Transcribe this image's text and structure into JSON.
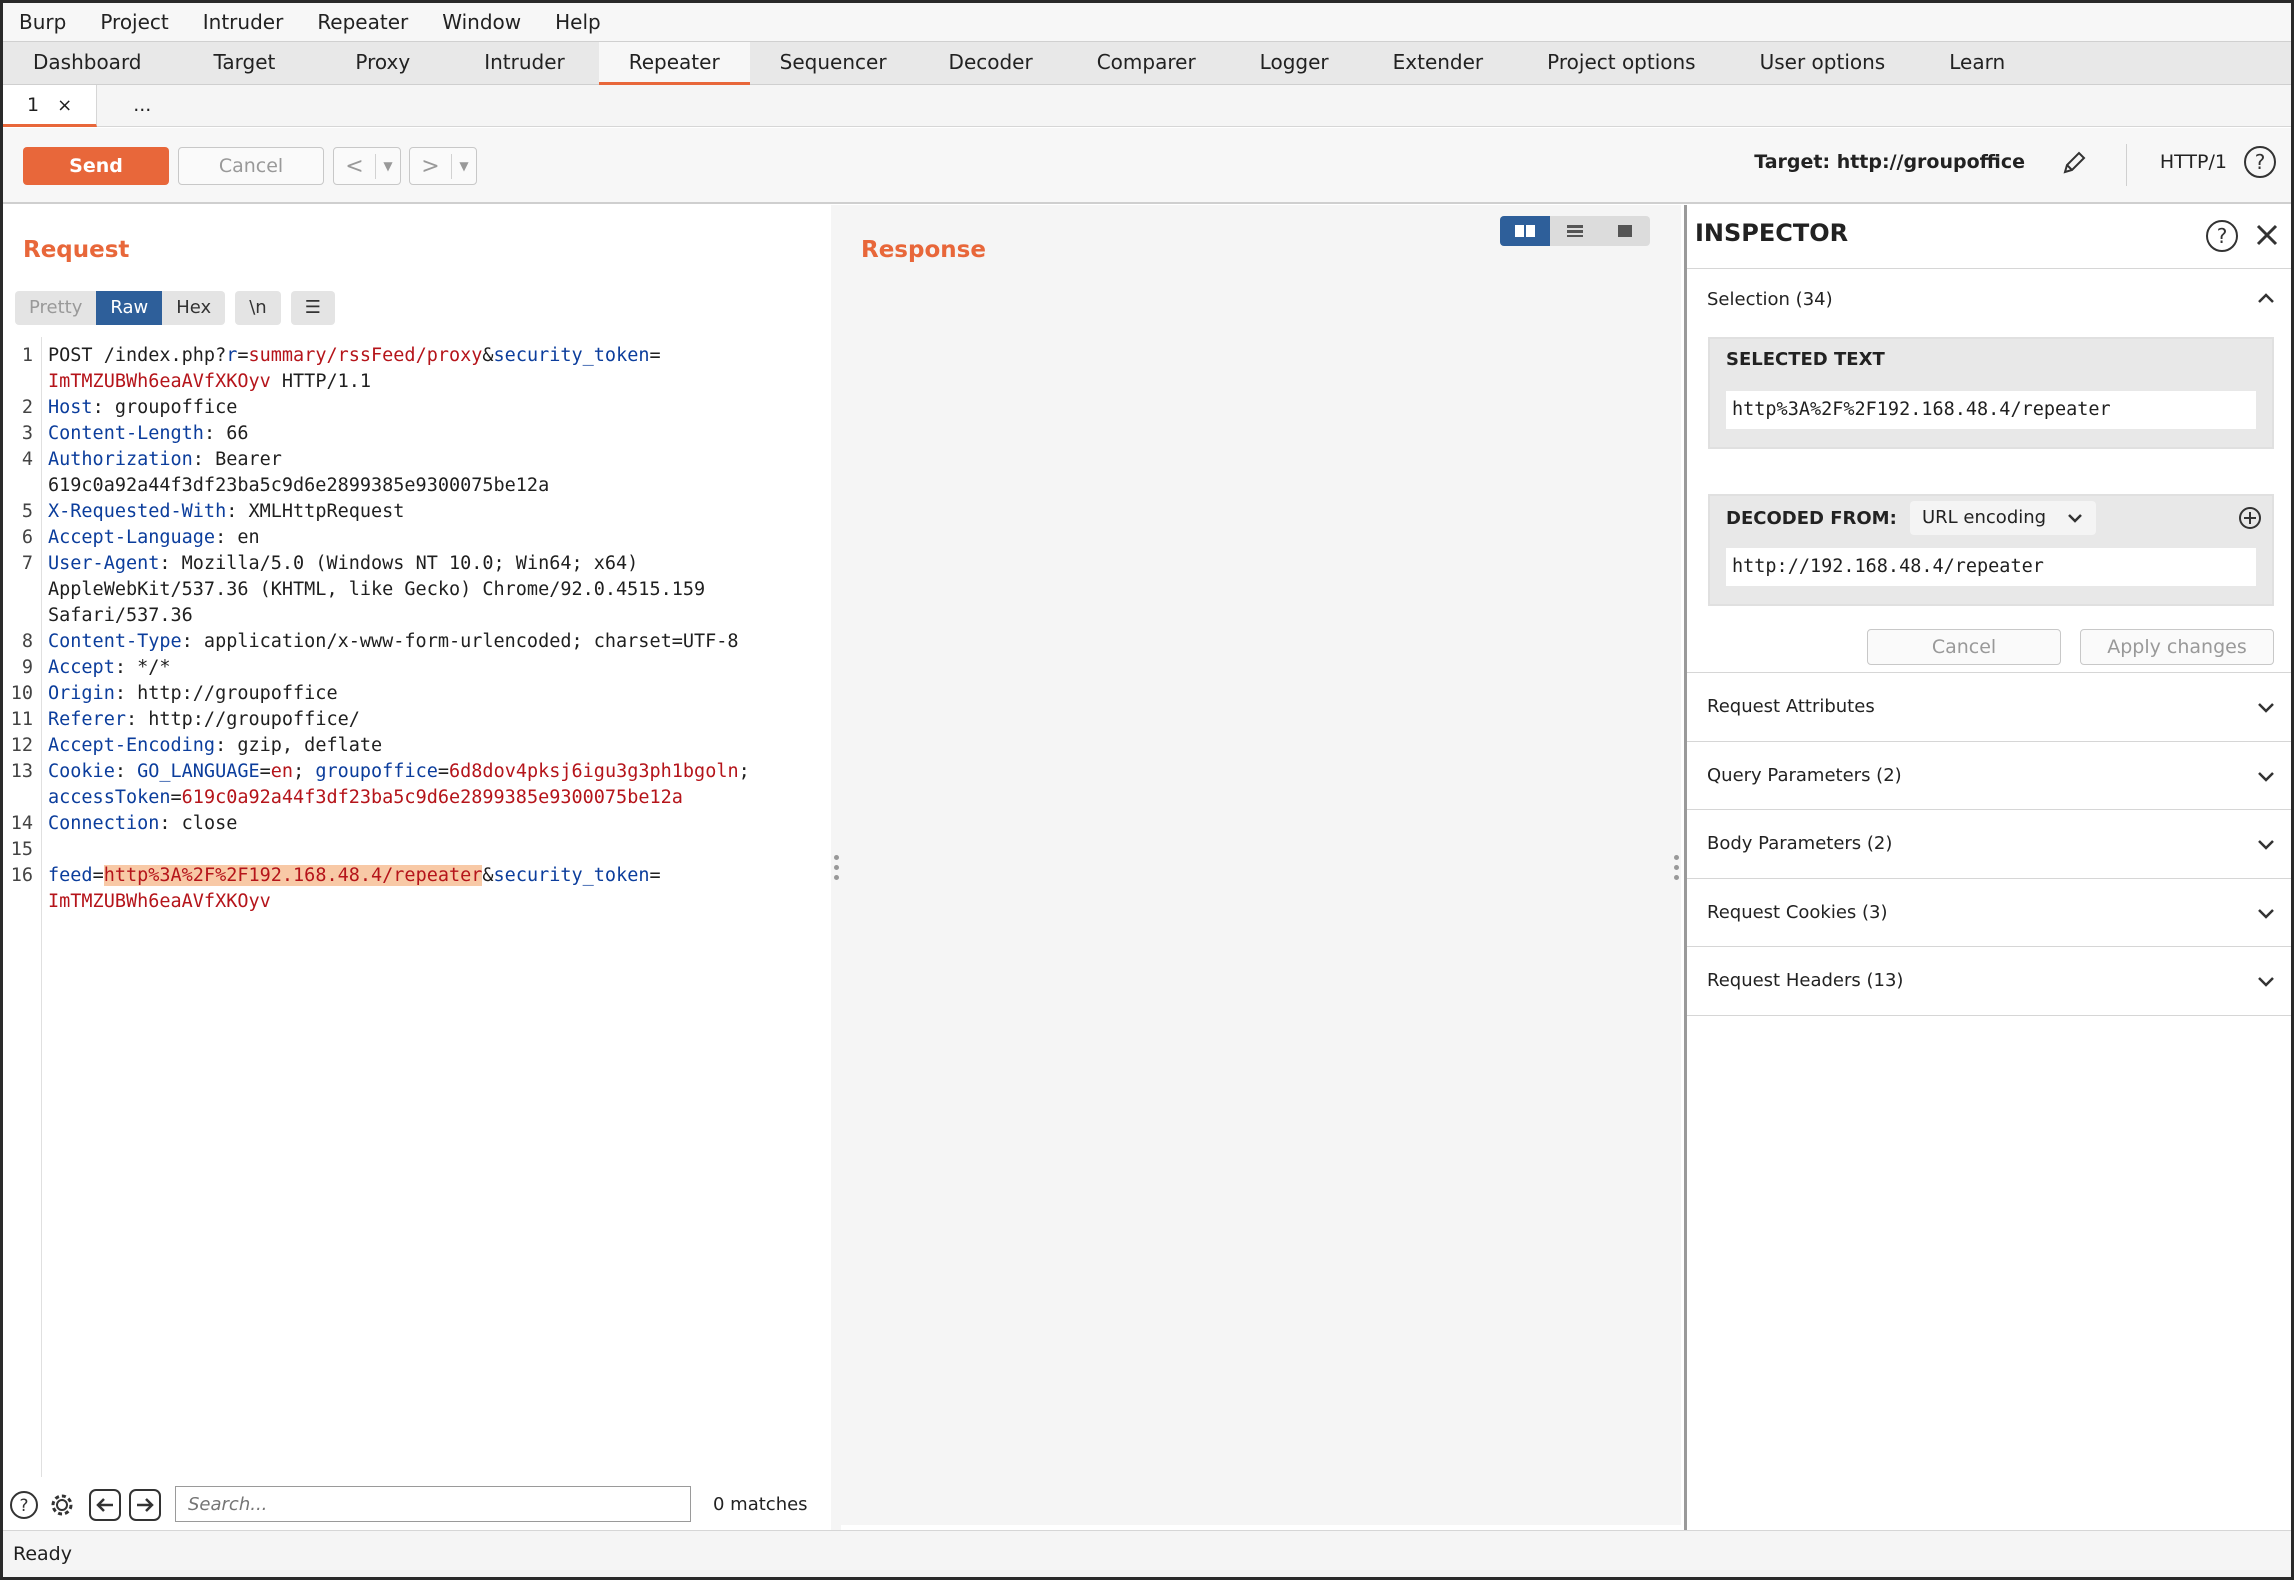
{
  "menu": [
    "Burp",
    "Project",
    "Intruder",
    "Repeater",
    "Window",
    "Help"
  ],
  "tabs": [
    "Dashboard",
    "Target",
    "Proxy",
    "Intruder",
    "Repeater",
    "Sequencer",
    "Decoder",
    "Comparer",
    "Logger",
    "Extender",
    "Project options",
    "User options",
    "Learn"
  ],
  "active_tab": "Repeater",
  "subtabs": {
    "tab1": "1",
    "close": "×",
    "more": "..."
  },
  "toolbar": {
    "send": "Send",
    "cancel": "Cancel",
    "back": "<",
    "forward": ">",
    "target": "Target: http://groupoffice",
    "protocol": "HTTP/1"
  },
  "request": {
    "title": "Request",
    "views": {
      "pretty": "Pretty",
      "raw": "Raw",
      "hex": "Hex",
      "newline": "\\n"
    },
    "active_view": "Raw",
    "lines": [
      {
        "n": "1",
        "segs": [
          {
            "t": "POST /index.php?"
          },
          {
            "t": "r",
            "c": "k"
          },
          {
            "t": "="
          },
          {
            "t": "summary/rssFeed/proxy",
            "c": "v"
          },
          {
            "t": "&"
          },
          {
            "t": "security_token",
            "c": "k"
          },
          {
            "t": "="
          }
        ]
      },
      {
        "n": "",
        "segs": [
          {
            "t": "ImTMZUBWh6eaAVfXKOyv",
            "c": "v"
          },
          {
            "t": " HTTP/1.1"
          }
        ]
      },
      {
        "n": "2",
        "segs": [
          {
            "t": "Host",
            "c": "k"
          },
          {
            "t": ": groupoffice"
          }
        ]
      },
      {
        "n": "3",
        "segs": [
          {
            "t": "Content-Length",
            "c": "k"
          },
          {
            "t": ": 66"
          }
        ]
      },
      {
        "n": "4",
        "segs": [
          {
            "t": "Authorization",
            "c": "k"
          },
          {
            "t": ": Bearer"
          }
        ]
      },
      {
        "n": "",
        "segs": [
          {
            "t": "619c0a92a44f3df23ba5c9d6e2899385e9300075be12a"
          }
        ]
      },
      {
        "n": "5",
        "segs": [
          {
            "t": "X-Requested-With",
            "c": "k"
          },
          {
            "t": ": XMLHttpRequest"
          }
        ]
      },
      {
        "n": "6",
        "segs": [
          {
            "t": "Accept-Language",
            "c": "k"
          },
          {
            "t": ": en"
          }
        ]
      },
      {
        "n": "7",
        "segs": [
          {
            "t": "User-Agent",
            "c": "k"
          },
          {
            "t": ": Mozilla/5.0 (Windows NT 10.0; Win64; x64)"
          }
        ]
      },
      {
        "n": "",
        "segs": [
          {
            "t": "AppleWebKit/537.36 (KHTML, like Gecko) Chrome/92.0.4515.159"
          }
        ]
      },
      {
        "n": "",
        "segs": [
          {
            "t": "Safari/537.36"
          }
        ]
      },
      {
        "n": "8",
        "segs": [
          {
            "t": "Content-Type",
            "c": "k"
          },
          {
            "t": ": application/x-www-form-urlencoded; charset=UTF-8"
          }
        ]
      },
      {
        "n": "9",
        "segs": [
          {
            "t": "Accept",
            "c": "k"
          },
          {
            "t": ": */*"
          }
        ]
      },
      {
        "n": "10",
        "segs": [
          {
            "t": "Origin",
            "c": "k"
          },
          {
            "t": ": http://groupoffice"
          }
        ]
      },
      {
        "n": "11",
        "segs": [
          {
            "t": "Referer",
            "c": "k"
          },
          {
            "t": ": http://groupoffice/"
          }
        ]
      },
      {
        "n": "12",
        "segs": [
          {
            "t": "Accept-Encoding",
            "c": "k"
          },
          {
            "t": ": gzip, deflate"
          }
        ]
      },
      {
        "n": "13",
        "segs": [
          {
            "t": "Cookie",
            "c": "k"
          },
          {
            "t": ": "
          },
          {
            "t": "GO_LANGUAGE",
            "c": "k"
          },
          {
            "t": "="
          },
          {
            "t": "en",
            "c": "v"
          },
          {
            "t": "; "
          },
          {
            "t": "groupoffice",
            "c": "k"
          },
          {
            "t": "="
          },
          {
            "t": "6d8dov4pksj6igu3g3ph1bgoln",
            "c": "v"
          },
          {
            "t": ";"
          }
        ]
      },
      {
        "n": "",
        "segs": [
          {
            "t": "accessToken",
            "c": "k"
          },
          {
            "t": "="
          },
          {
            "t": "619c0a92a44f3df23ba5c9d6e2899385e9300075be12a",
            "c": "v"
          }
        ]
      },
      {
        "n": "14",
        "segs": [
          {
            "t": "Connection",
            "c": "k"
          },
          {
            "t": ": close"
          }
        ]
      },
      {
        "n": "15",
        "segs": []
      },
      {
        "n": "16",
        "segs": [
          {
            "t": "feed",
            "c": "k"
          },
          {
            "t": "="
          },
          {
            "t": "http%3A%2F%2F192.168.48.4/repeater",
            "c": "hl"
          },
          {
            "t": "&"
          },
          {
            "t": "security_token",
            "c": "k"
          },
          {
            "t": "="
          }
        ]
      },
      {
        "n": "",
        "segs": [
          {
            "t": "ImTMZUBWh6eaAVfXKOyv",
            "c": "v"
          }
        ]
      }
    ]
  },
  "response": {
    "title": "Response"
  },
  "search": {
    "placeholder": "Search...",
    "matches": "0 matches"
  },
  "inspector": {
    "title": "INSPECTOR",
    "selection_label": "Selection (34)",
    "selected_text_header": "SELECTED TEXT",
    "selected_text": "http%3A%2F%2F192.168.48.4/repeater",
    "decoded_from_header": "DECODED FROM:",
    "encoding": "URL encoding",
    "decoded_text": "http://192.168.48.4/repeater",
    "cancel": "Cancel",
    "apply": "Apply changes",
    "sections": [
      "Request Attributes",
      "Query Parameters (2)",
      "Body Parameters (2)",
      "Request Cookies (3)",
      "Request Headers (13)"
    ]
  },
  "status": "Ready",
  "colors": {
    "accent": "#e8673a",
    "active_blue": "#2e5f9a",
    "key": "#0b3d9c",
    "value": "#b5141a",
    "highlight": "#f8c9a6"
  }
}
